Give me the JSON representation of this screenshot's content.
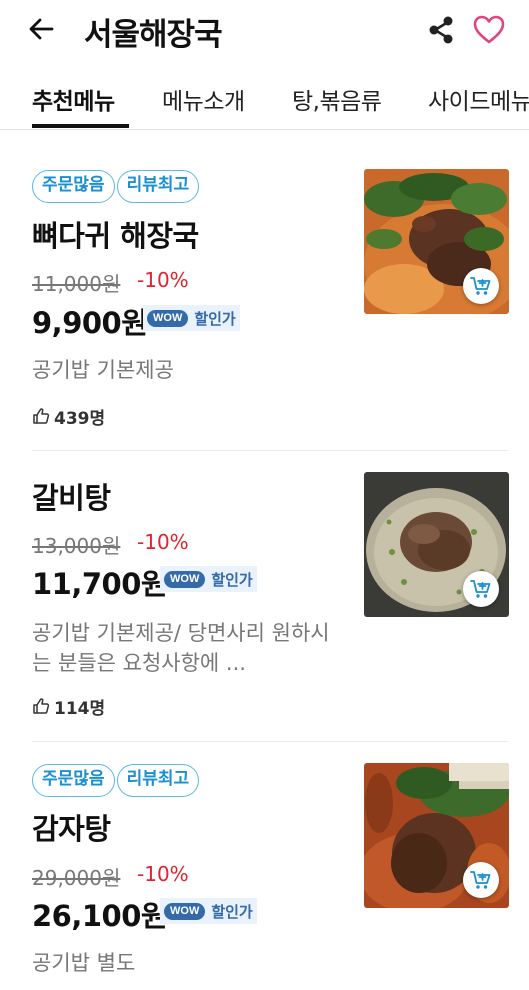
{
  "header": {
    "title": "서울해장국",
    "back_icon": "arrow-left-icon",
    "share_icon": "share-icon",
    "heart_icon": "heart-outline-icon",
    "accent_color": "#e0457b"
  },
  "tabs": [
    {
      "label": "추천메뉴",
      "active": true
    },
    {
      "label": "메뉴소개",
      "active": false
    },
    {
      "label": "탕,볶음류",
      "active": false
    },
    {
      "label": "사이드메뉴",
      "active": false
    }
  ],
  "menu_items": [
    {
      "badges": [
        "주문많음",
        "리뷰최고"
      ],
      "name": "뼈다귀 해장국",
      "original_price": "11,000원",
      "discount": "-10%",
      "price": "9,900원",
      "wow_logo": "WOW",
      "wow_label": "할인가",
      "description": "공기밥 기본제공",
      "likes": "439명"
    },
    {
      "badges": [],
      "name": "갈비탕",
      "original_price": "13,000원",
      "discount": "-10%",
      "price": "11,700원",
      "wow_logo": "WOW",
      "wow_label": "할인가",
      "description": "공기밥 기본제공/ 당면사리 원하시는 분들은 요청사항에 ...",
      "likes": "114명"
    },
    {
      "badges": [
        "주문많음",
        "리뷰최고"
      ],
      "name": "감자탕",
      "original_price": "29,000원",
      "discount": "-10%",
      "price": "26,100원",
      "wow_logo": "WOW",
      "wow_label": "할인가",
      "description": "공기밥 별도",
      "likes": ""
    }
  ],
  "colors": {
    "badge_border": "#5bb8e8",
    "badge_text": "#1a8fd1",
    "discount": "#e2232e",
    "wow": "#346aa9",
    "cart": "#1a8fd1"
  }
}
